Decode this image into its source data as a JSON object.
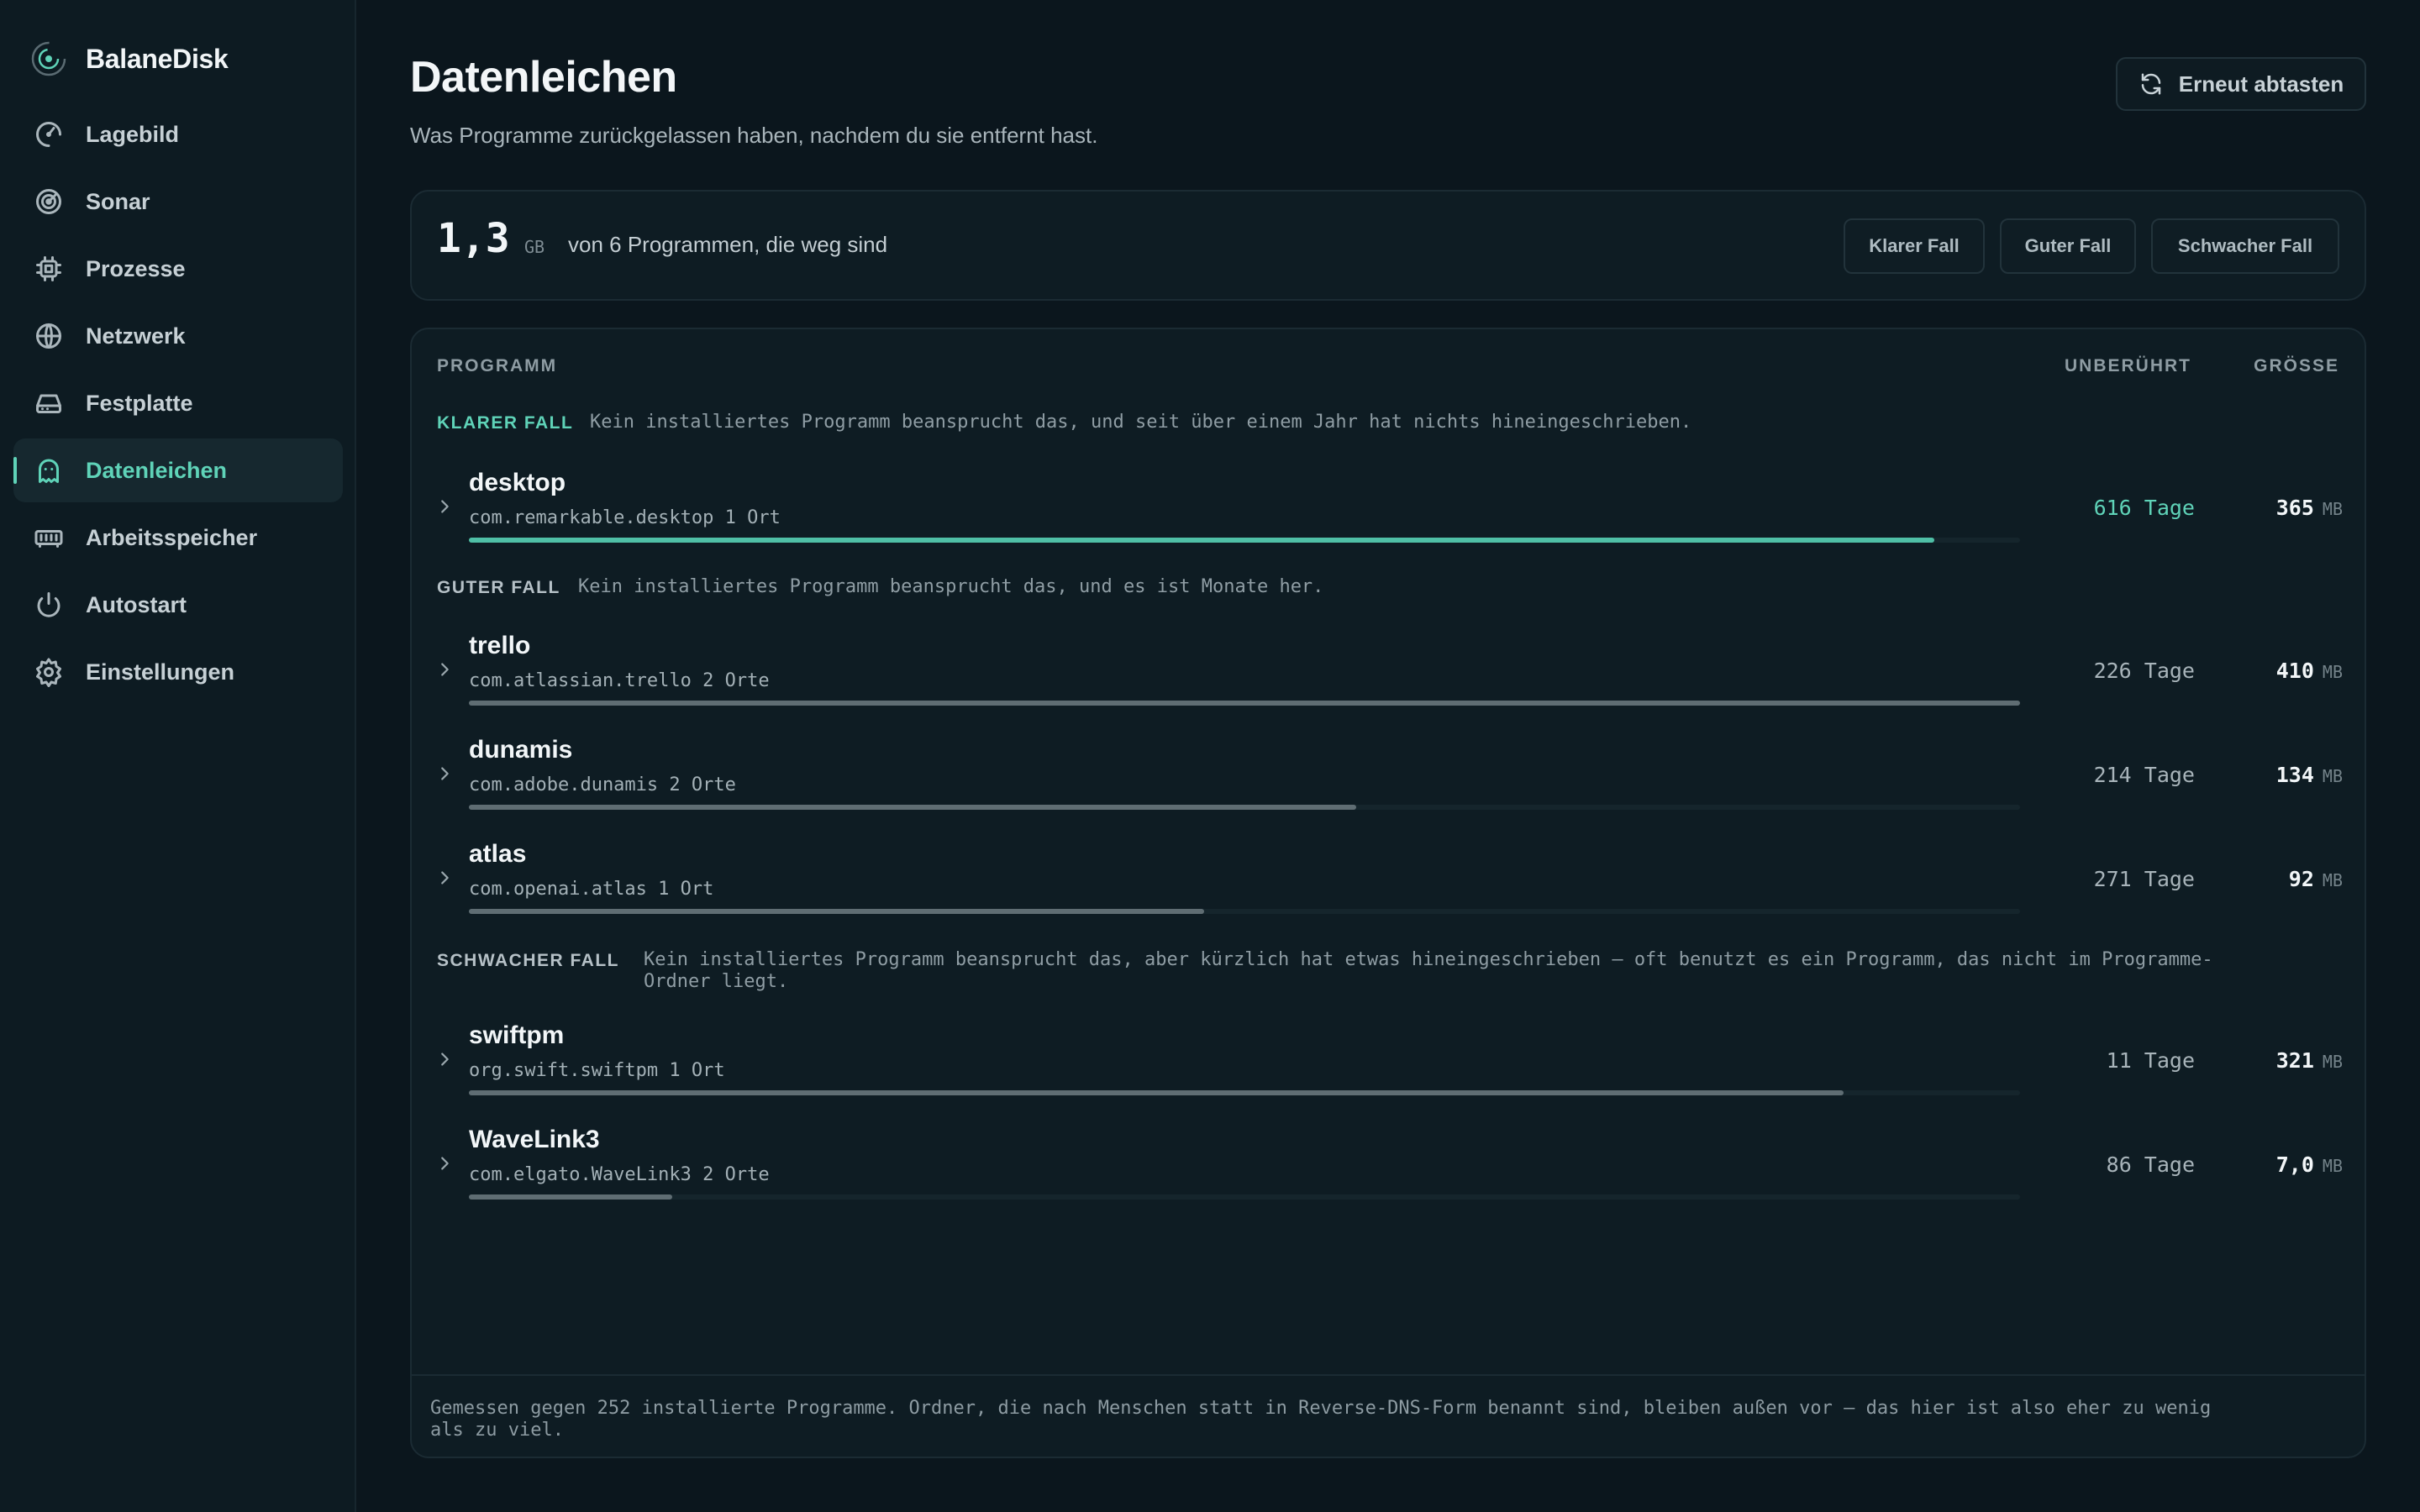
{
  "app": {
    "name": "BalaneDisk"
  },
  "sidebar": {
    "items": [
      {
        "label": "Lagebild",
        "icon": "gauge-icon"
      },
      {
        "label": "Sonar",
        "icon": "radar-icon"
      },
      {
        "label": "Prozesse",
        "icon": "cpu-icon"
      },
      {
        "label": "Netzwerk",
        "icon": "globe-icon"
      },
      {
        "label": "Festplatte",
        "icon": "hard-drive-icon"
      },
      {
        "label": "Datenleichen",
        "icon": "ghost-icon",
        "active": true
      },
      {
        "label": "Arbeitsspeicher",
        "icon": "memory-icon"
      },
      {
        "label": "Autostart",
        "icon": "power-icon"
      },
      {
        "label": "Einstellungen",
        "icon": "gear-icon"
      }
    ]
  },
  "header": {
    "title": "Datenleichen",
    "subtitle": "Was Programme zurückgelassen haben, nachdem du sie entfernt hast.",
    "rescan_label": "Erneut abtasten"
  },
  "summary": {
    "total": "1,3",
    "unit": "GB",
    "description": "von 6 Programmen, die weg sind",
    "filters": [
      "Klarer Fall",
      "Guter Fall",
      "Schwacher Fall"
    ]
  },
  "table": {
    "columns": {
      "program": "PROGRAMM",
      "untouched": "UNBERÜHRT",
      "size": "GRÖSSE"
    },
    "groups": [
      {
        "label": "KLARER FALL",
        "description": "Kein installiertes Programm beansprucht das, und seit über einem Jahr hat nichts hineingeschrieben.",
        "rows": [
          {
            "name": "desktop",
            "id": "com.remarkable.desktop",
            "places": "1 Ort",
            "days": "616 Tage",
            "size": "365",
            "size_unit": "MB",
            "bar": 0.945
          }
        ]
      },
      {
        "label": "GUTER FALL",
        "description": "Kein installiertes Programm beansprucht das, und es ist Monate her.",
        "rows": [
          {
            "name": "trello",
            "id": "com.atlassian.trello",
            "places": "2 Orte",
            "days": "226 Tage",
            "size": "410",
            "size_unit": "MB",
            "bar": 1.0
          },
          {
            "name": "dunamis",
            "id": "com.adobe.dunamis",
            "places": "2 Orte",
            "days": "214 Tage",
            "size": "134",
            "size_unit": "MB",
            "bar": 0.572
          },
          {
            "name": "atlas",
            "id": "com.openai.atlas",
            "places": "1 Ort",
            "days": "271 Tage",
            "size": "92",
            "size_unit": "MB",
            "bar": 0.474
          }
        ]
      },
      {
        "label": "SCHWACHER FALL",
        "description_line1": "Kein installiertes Programm beansprucht das, aber kürzlich hat etwas hineingeschrieben – oft benutzt es ein Programm, das nicht im Programme-",
        "description_line2": "Ordner liegt.",
        "rows": [
          {
            "name": "swiftpm",
            "id": "org.swift.swiftpm",
            "places": "1 Ort",
            "days": "11 Tage",
            "size": "321",
            "size_unit": "MB",
            "bar": 0.886
          },
          {
            "name": "WaveLink3",
            "id": "com.elgato.WaveLink3",
            "places": "2 Orte",
            "days": "86 Tage",
            "size": "7,0",
            "size_unit": "MB",
            "bar": 0.131
          }
        ]
      }
    ],
    "footer_line1": "Gemessen gegen 252 installierte Programme. Ordner, die nach Menschen statt in Reverse-DNS-Form benannt sind, bleiben außen vor – das hier ist also eher zu wenig",
    "footer_line2": "als zu viel."
  },
  "colors": {
    "accent": "#5fd3b8",
    "background": "#0b161d",
    "sidebar": "#0d1b22",
    "card": "#0e1c23"
  }
}
